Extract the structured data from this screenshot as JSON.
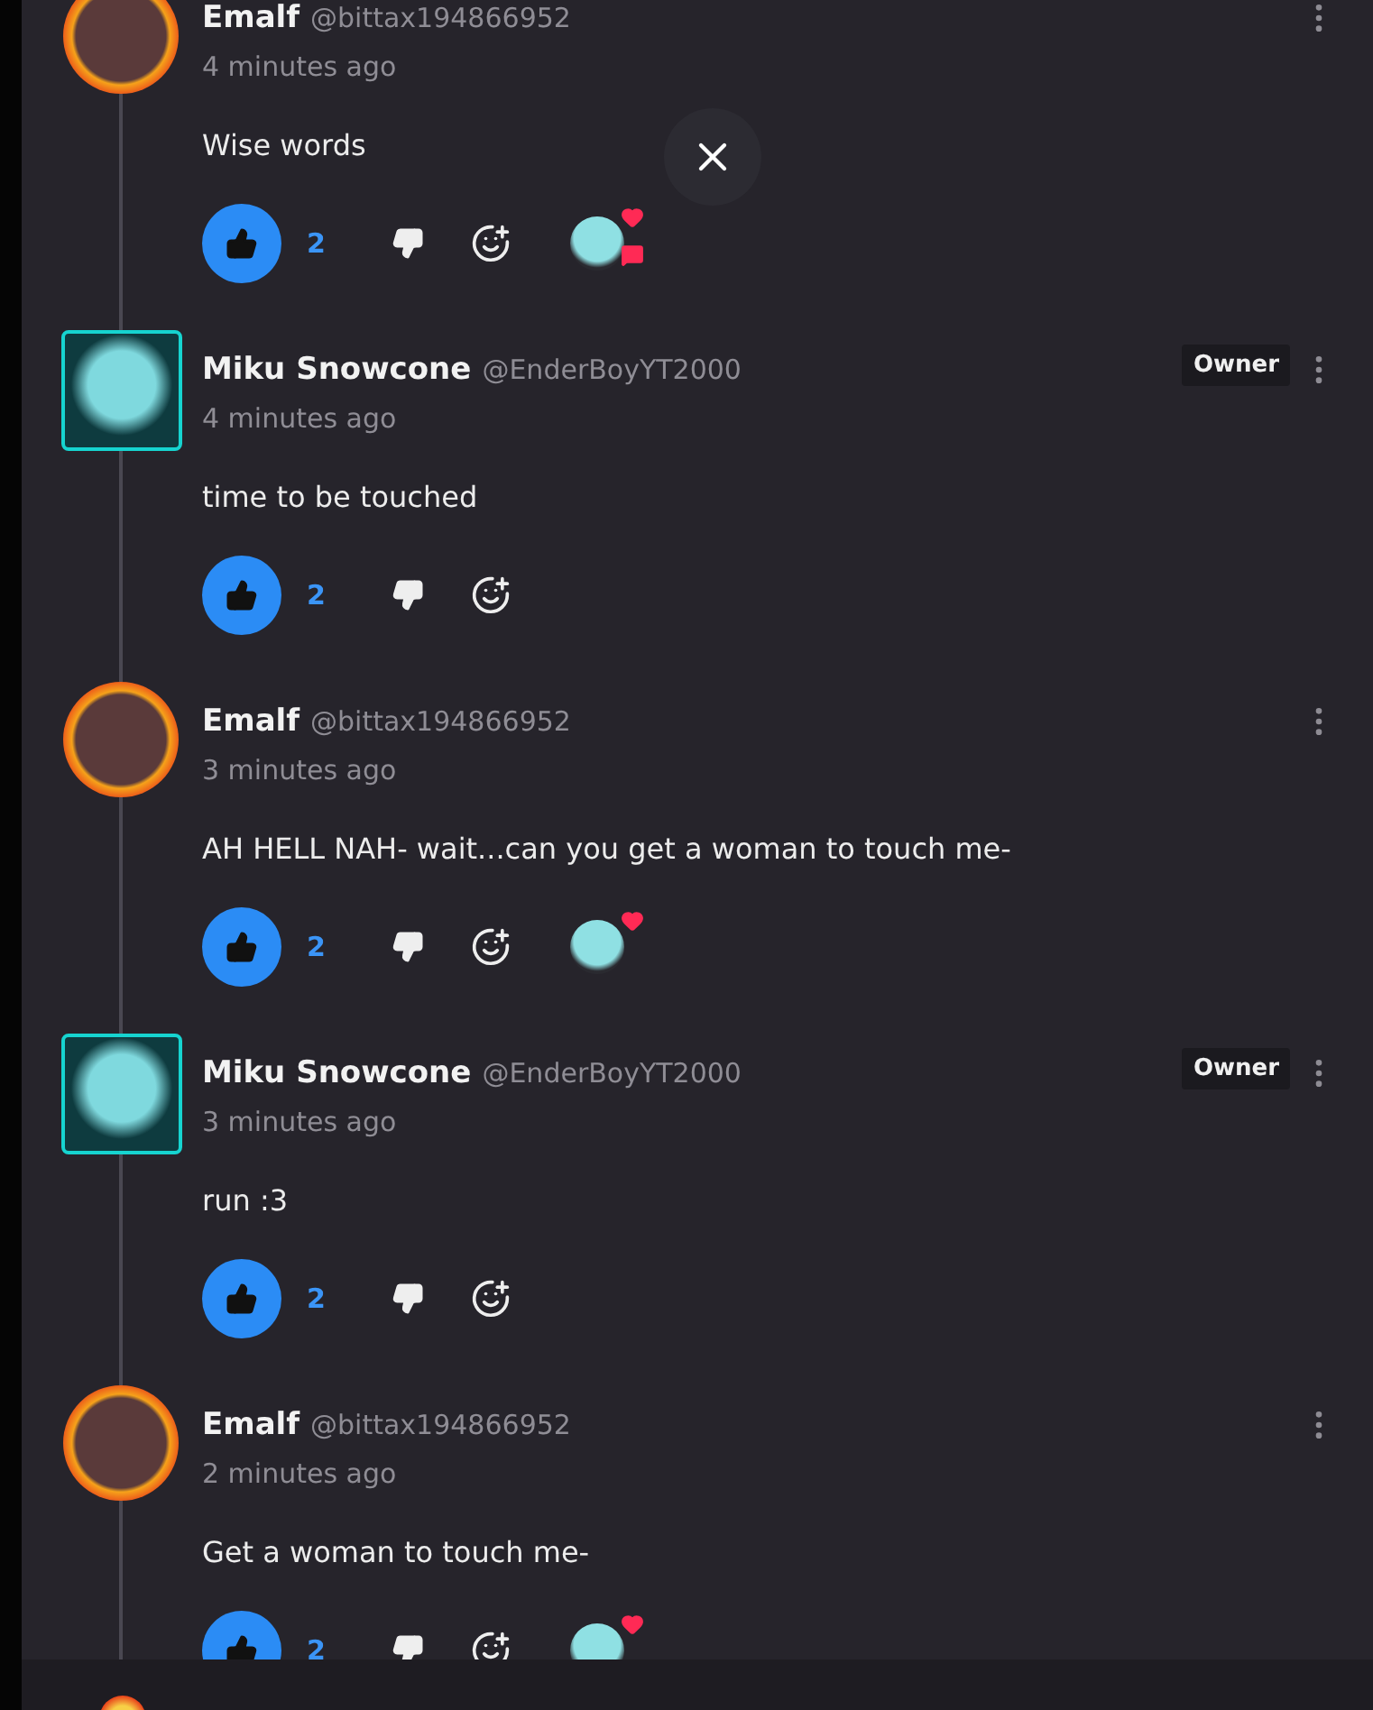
{
  "comments": [
    {
      "author": "Emalf",
      "handle": "@bittax194866952",
      "time": "4 minutes ago",
      "text": "Wise words",
      "kind": "flame",
      "liked": true,
      "likes": "2",
      "hearted": true,
      "creator_replied": true
    },
    {
      "author": "Miku Snowcone",
      "handle": "@EnderBoyYT2000",
      "time": "4 minutes ago",
      "text": "time to be touched",
      "kind": "frame",
      "owner_badge": "Owner",
      "liked": true,
      "likes": "2",
      "hearted": false,
      "creator_replied": false
    },
    {
      "author": "Emalf",
      "handle": "@bittax194866952",
      "time": "3 minutes ago",
      "text": "AH HELL NAH- wait...can you get a woman to touch me-",
      "kind": "flame",
      "liked": true,
      "likes": "2",
      "hearted": true,
      "creator_replied": false
    },
    {
      "author": "Miku Snowcone",
      "handle": "@EnderBoyYT2000",
      "time": "3 minutes ago",
      "text": "run :3",
      "kind": "frame",
      "owner_badge": "Owner",
      "liked": true,
      "likes": "2",
      "hearted": false,
      "creator_replied": false
    },
    {
      "author": "Emalf",
      "handle": "@bittax194866952",
      "time": "2 minutes ago",
      "text": "Get a woman to touch me-",
      "kind": "flame",
      "liked": true,
      "likes": "2",
      "hearted": true,
      "creator_replied": false
    }
  ]
}
